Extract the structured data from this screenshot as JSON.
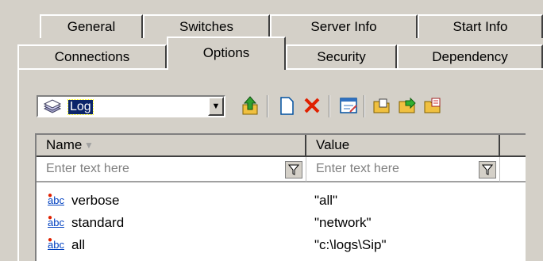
{
  "tabs_row1": [
    "General",
    "Switches",
    "Server Info",
    "Start Info"
  ],
  "tabs_row2": [
    "Connections",
    "Options",
    "Security",
    "Dependency"
  ],
  "combo": {
    "value": "Log"
  },
  "grid": {
    "columns": [
      "Name",
      "Value"
    ],
    "filter_placeholder": "Enter text here",
    "rows": [
      {
        "type": "abc",
        "name": "verbose",
        "value": "\"all\""
      },
      {
        "type": "abc",
        "name": "standard",
        "value": "\"network\""
      },
      {
        "type": "abc",
        "name": "all",
        "value": "\"c:\\logs\\Sip\""
      }
    ]
  }
}
